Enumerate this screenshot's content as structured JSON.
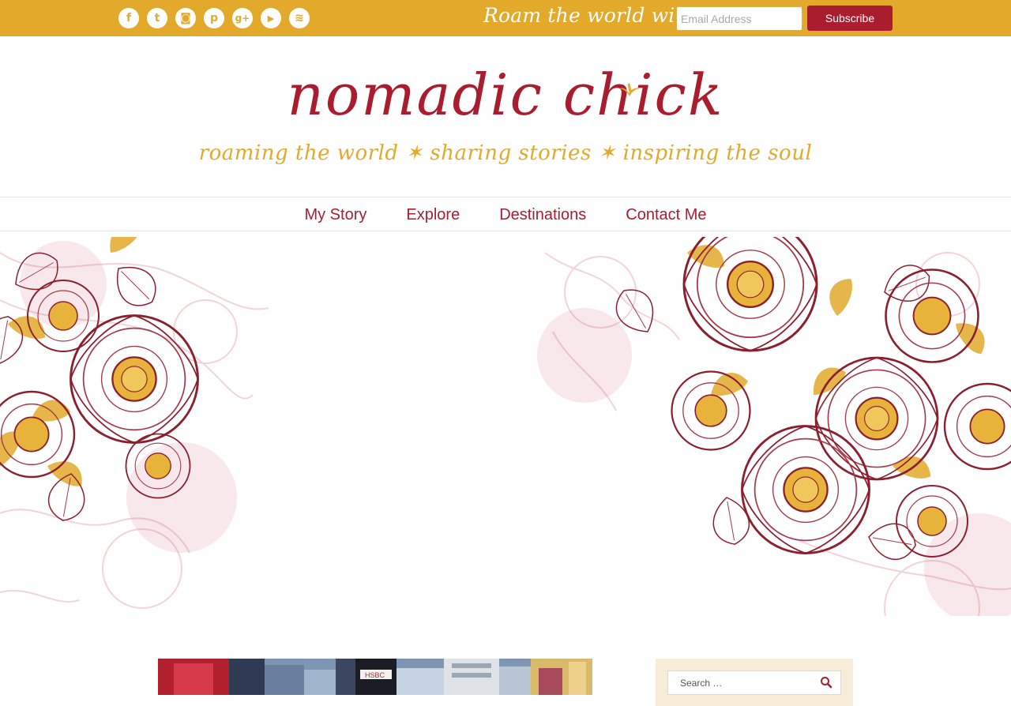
{
  "topbar": {
    "social_icons": [
      {
        "name": "facebook-icon",
        "glyph": "f"
      },
      {
        "name": "twitter-icon",
        "glyph": "t"
      },
      {
        "name": "instagram-icon",
        "glyph": "◙"
      },
      {
        "name": "pinterest-icon",
        "glyph": "p"
      },
      {
        "name": "google-plus-icon",
        "glyph": "g+"
      },
      {
        "name": "youtube-icon",
        "glyph": "▶"
      },
      {
        "name": "rss-icon",
        "glyph": "≋"
      }
    ],
    "tagline": "Roam the world with me...",
    "email_placeholder": "Email Address",
    "subscribe_label": "Subscribe"
  },
  "logo": {
    "title": "nomadic chick",
    "subtitle": "roaming the world ✶ sharing stories ✶ inspiring the soul"
  },
  "nav": {
    "items": [
      "My Story",
      "Explore",
      "Destinations",
      "Contact Me"
    ]
  },
  "sidebar": {
    "search_placeholder": "Search …"
  },
  "photo": {
    "sign_text": "HSBC"
  },
  "colors": {
    "gold": "#e2a92b",
    "crimson": "#a91d2e",
    "cream": "#f6ecd8"
  }
}
